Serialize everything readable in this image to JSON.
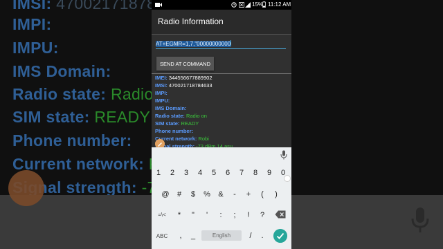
{
  "background": {
    "lines": [
      {
        "label": "IMSI:",
        "value": "47002171878"
      },
      {
        "label": "IMPI:",
        "value": ""
      },
      {
        "label": "IMPU:",
        "value": ""
      },
      {
        "label": "IMS Domain:",
        "value": ""
      },
      {
        "label": "Radio state:",
        "value": "Radio"
      },
      {
        "label": "SIM state:",
        "value": "READY"
      },
      {
        "label": "Phone number:",
        "value": ""
      },
      {
        "label": "Current network:",
        "value": "R"
      },
      {
        "label": "Signal strength:",
        "value": "-7"
      }
    ]
  },
  "statusbar": {
    "left_icon": "video-camera-icon",
    "battery": "15%",
    "time": "11:12 AM"
  },
  "app": {
    "title": "Radio Information"
  },
  "at_command": {
    "selected": "AT+EGMR=1,7,\"00000000000"
  },
  "send_button": {
    "label": "SEND AT COMMAND"
  },
  "info": [
    {
      "label": "IMEI:",
      "value": "344556677889902",
      "color": "white"
    },
    {
      "label": "IMSI:",
      "value": "470021718784633",
      "color": "white"
    },
    {
      "label": "IMPI:",
      "value": "",
      "color": "white"
    },
    {
      "label": "IMPU:",
      "value": "",
      "color": "white"
    },
    {
      "label": "IMS Domain:",
      "value": "",
      "color": "white"
    },
    {
      "label": "Radio state:",
      "value": "Radio on",
      "color": "green"
    },
    {
      "label": "SIM state:",
      "value": "READY",
      "color": "green"
    },
    {
      "label": "Phone number:",
      "value": "",
      "color": "green"
    },
    {
      "label": "Current network:",
      "value": "Robi",
      "color": "green"
    },
    {
      "label": "Signal strength:",
      "value": "-73 dBm   14 asu",
      "color": "green"
    }
  ],
  "keyboard": {
    "row1": [
      "1",
      "2",
      "3",
      "4",
      "5",
      "6",
      "7",
      "8",
      "9",
      "0"
    ],
    "row2": [
      "@",
      "#",
      "$",
      "%",
      "&",
      "-",
      "+",
      "(",
      ")"
    ],
    "row3": [
      "=\\<",
      "*",
      "\"",
      "'",
      ":",
      ";",
      "!",
      "?"
    ],
    "abc_label": "ABC",
    "comma": ",",
    "underscore": "_",
    "space_label": "English",
    "slash": "/",
    "period": "."
  },
  "colors": {
    "label_blue": "#5b9cff",
    "value_green": "#3bc93b",
    "accent_teal": "#26a69a"
  }
}
